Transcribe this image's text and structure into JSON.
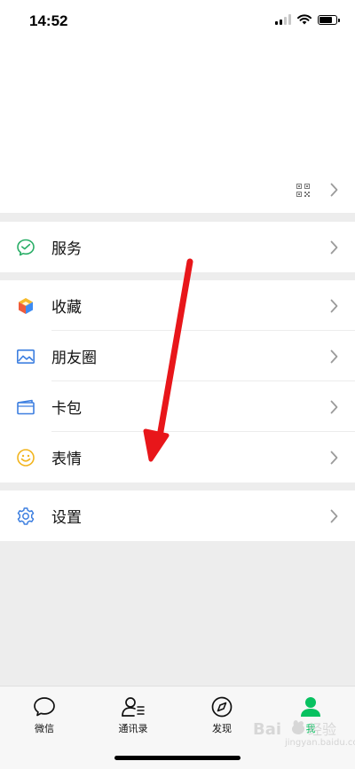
{
  "status_bar": {
    "time": "14:52"
  },
  "menu": {
    "services": {
      "label": "服务"
    },
    "favorites": {
      "label": "收藏"
    },
    "moments": {
      "label": "朋友圈"
    },
    "cards": {
      "label": "卡包"
    },
    "stickers": {
      "label": "表情"
    },
    "settings": {
      "label": "设置"
    }
  },
  "tabs": [
    {
      "label": "微信",
      "icon": "chat-bubble-icon"
    },
    {
      "label": "通讯录",
      "icon": "contacts-icon"
    },
    {
      "label": "发现",
      "icon": "compass-icon"
    },
    {
      "label": "我",
      "icon": "person-icon",
      "active": true
    }
  ],
  "watermark": {
    "text": "jingyan.baidu.com"
  },
  "colors": {
    "accent": "#07c160",
    "annotation_arrow": "#e8161a",
    "background": "#ededed"
  }
}
